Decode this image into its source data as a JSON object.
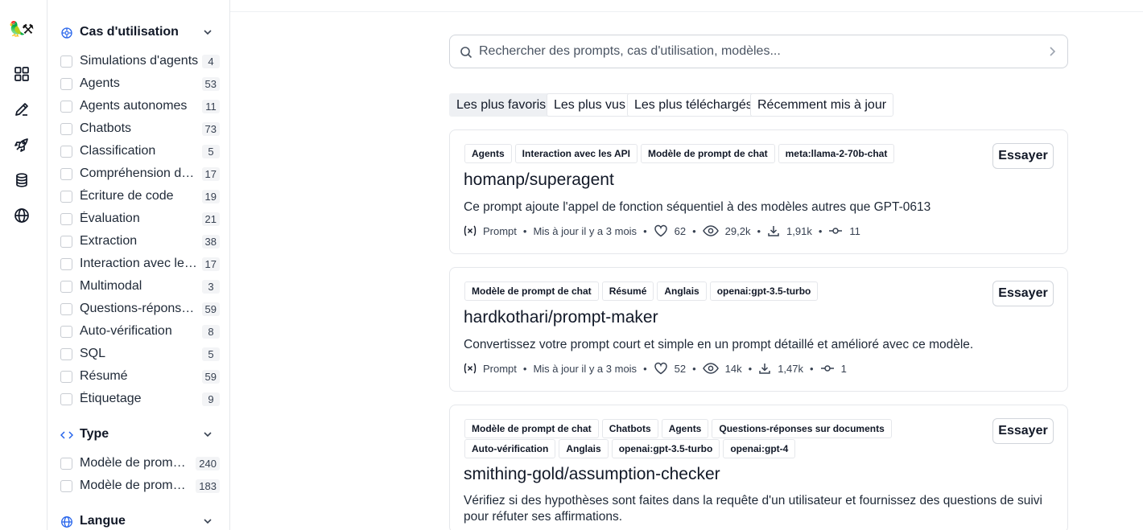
{
  "sidebar": {
    "use_cases": {
      "title": "Cas d'utilisation",
      "items": [
        {
          "label": "Simulations d'agents",
          "count": "4"
        },
        {
          "label": "Agents",
          "count": "53"
        },
        {
          "label": "Agents autonomes",
          "count": "11"
        },
        {
          "label": "Chatbots",
          "count": "73"
        },
        {
          "label": "Classification",
          "count": "5"
        },
        {
          "label": "Compréhension de code",
          "count": "17"
        },
        {
          "label": "Écriture de code",
          "count": "19"
        },
        {
          "label": "Évaluation",
          "count": "21"
        },
        {
          "label": "Extraction",
          "count": "38"
        },
        {
          "label": "Interaction avec les API",
          "count": "17"
        },
        {
          "label": "Multimodal",
          "count": "3"
        },
        {
          "label": "Questions-réponses sur documents",
          "count": "59"
        },
        {
          "label": "Auto-vérification",
          "count": "8"
        },
        {
          "label": "SQL",
          "count": "5"
        },
        {
          "label": "Résumé",
          "count": "59"
        },
        {
          "label": "Étiquetage",
          "count": "9"
        }
      ]
    },
    "type": {
      "title": "Type",
      "items": [
        {
          "label": "Modèle de prompt de chat",
          "count": "240"
        },
        {
          "label": "Modèle de prompt de chaîne",
          "count": "183"
        }
      ]
    },
    "language": {
      "title": "Langue"
    }
  },
  "search": {
    "placeholder": "Rechercher des prompts, cas d'utilisation, modèles..."
  },
  "tabs": [
    "Les plus favoris",
    "Les plus vus",
    "Les plus téléchargés",
    "Récemment mis à jour"
  ],
  "cards": [
    {
      "tags": [
        "Agents",
        "Interaction avec les API",
        "Modèle de prompt de chat",
        "meta:llama-2-70b-chat"
      ],
      "title": "homanp/superagent",
      "description": "Ce prompt ajoute l'appel de fonction séquentiel à des modèles autres que GPT-0613",
      "kind": "Prompt",
      "updated": "Mis à jour il y a 3 mois",
      "likes": "62",
      "views": "29,2k",
      "downloads": "1,91k",
      "commits": "11",
      "try_label": "Essayer"
    },
    {
      "tags": [
        "Modèle de prompt de chat",
        "Résumé",
        "Anglais",
        "openai:gpt-3.5-turbo"
      ],
      "title": "hardkothari/prompt-maker",
      "description": "Convertissez votre prompt court et simple en un prompt détaillé et amélioré avec ce modèle.",
      "kind": "Prompt",
      "updated": "Mis à jour il y a 3 mois",
      "likes": "52",
      "views": "14k",
      "downloads": "1,47k",
      "commits": "1",
      "try_label": "Essayer"
    },
    {
      "tags": [
        "Modèle de prompt de chat",
        "Chatbots",
        "Agents",
        "Questions-réponses sur documents",
        "Auto-vérification",
        "Anglais",
        "openai:gpt-3.5-turbo",
        "openai:gpt-4"
      ],
      "title": "smithing-gold/assumption-checker",
      "description": "Vérifiez si des hypothèses sont faites dans la requête d'un utilisateur et fournissez des questions de suivi pour réfuter ses affirmations.",
      "try_label": "Essayer"
    }
  ],
  "icons": {
    "rail": [
      "logo-icon",
      "grid-icon",
      "pencil-icon",
      "rocket-icon",
      "database-icon",
      "globe-icon"
    ],
    "sections": [
      "use-cases-icon",
      "code-icon",
      "globe-icon"
    ],
    "meta": [
      "variable-icon",
      "heart-icon",
      "eye-icon",
      "download-icon",
      "commit-icon"
    ]
  }
}
